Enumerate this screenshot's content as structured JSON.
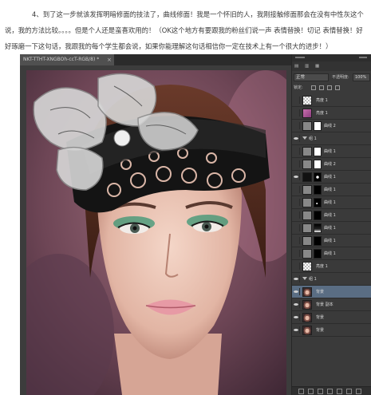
{
  "article": {
    "paragraph": "4、到了这一步就该发挥明暗修面的技法了，曲线修面！我是一个怀旧的人，我刚接触修面那会在没有中性灰这个说，我的方法比较。。。。但是个人还是蛮喜欢用的！（OK这个地方有要跟我的粉丝们说一声 表情替换！切记 表情替换！好好琢磨一下这句话，我跟我的每个学生都会说，如果你能理解这句话相信你一定在技术上有一个很大的进步！）"
  },
  "photoshop": {
    "document_tab": "NKT-TTHT-XNGBOh-ccT-RGB/8) *",
    "layers_panel": {
      "blend_mode": "正常",
      "opacity_label": "不透明度:",
      "opacity_value": "100%",
      "lock_label": "锁定:",
      "layers": [
        {
          "name": "亮度 1",
          "thumb": "checker",
          "visible": false,
          "mask": false,
          "group": false
        },
        {
          "name": "亮度 1",
          "thumb": "purple",
          "visible": false,
          "mask": false,
          "group": false
        },
        {
          "name": "曲线 2",
          "thumb": "grey",
          "visible": false,
          "mask": true,
          "mask_style": "",
          "group": false
        },
        {
          "name": "组 1",
          "thumb": "",
          "visible": true,
          "mask": false,
          "group": true
        },
        {
          "name": "曲线 1",
          "thumb": "grey",
          "visible": false,
          "mask": true,
          "mask_style": "",
          "group": false
        },
        {
          "name": "曲线 2",
          "thumb": "grey",
          "visible": false,
          "mask": true,
          "mask_style": "",
          "group": false
        },
        {
          "name": "曲线 1",
          "thumb": "dark",
          "visible": true,
          "mask": true,
          "mask_style": "b1",
          "group": false
        },
        {
          "name": "曲线 1",
          "thumb": "grey",
          "visible": false,
          "mask": true,
          "mask_style": "b2",
          "group": false
        },
        {
          "name": "曲线 1",
          "thumb": "grey",
          "visible": false,
          "mask": true,
          "mask_style": "b4",
          "group": false
        },
        {
          "name": "曲线 1",
          "thumb": "grey",
          "visible": false,
          "mask": true,
          "mask_style": "b2",
          "group": false
        },
        {
          "name": "曲线 1",
          "thumb": "grey",
          "visible": false,
          "mask": true,
          "mask_style": "b3",
          "group": false
        },
        {
          "name": "曲线 1",
          "thumb": "grey",
          "visible": false,
          "mask": true,
          "mask_style": "b2",
          "group": false
        },
        {
          "name": "曲线 1",
          "thumb": "grey",
          "visible": false,
          "mask": true,
          "mask_style": "b2",
          "group": false
        },
        {
          "name": "亮度 1",
          "thumb": "checker",
          "visible": false,
          "mask": false,
          "group": false
        },
        {
          "name": "组 1",
          "thumb": "",
          "visible": true,
          "mask": false,
          "group": true
        },
        {
          "name": "背景",
          "thumb": "face",
          "visible": true,
          "mask": false,
          "group": false,
          "selected": true
        },
        {
          "name": "背景 副本",
          "thumb": "face",
          "visible": true,
          "mask": false,
          "group": false
        },
        {
          "name": "背景",
          "thumb": "face",
          "visible": true,
          "mask": false,
          "group": false
        },
        {
          "name": "背景",
          "thumb": "face",
          "visible": true,
          "mask": false,
          "group": false
        }
      ]
    }
  }
}
